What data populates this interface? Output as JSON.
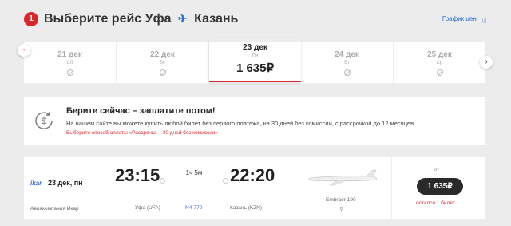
{
  "header": {
    "step": "1",
    "title_prefix": "Выберите рейс",
    "origin": "Уфа",
    "destination": "Казань",
    "schedule_link": "График цен",
    "plane_icon": "airplane-icon"
  },
  "dates": [
    {
      "date": "21 дек",
      "weekday": "Сб",
      "available": false
    },
    {
      "date": "22 дек",
      "weekday": "Вс",
      "available": false
    },
    {
      "date": "23 дек",
      "weekday": "Пн",
      "price": "1 635₽",
      "available": true,
      "selected": true
    },
    {
      "date": "24 дек",
      "weekday": "Вт",
      "available": false
    },
    {
      "date": "25 дек",
      "weekday": "Ср",
      "available": false
    }
  ],
  "nav": {
    "prev": "‹",
    "next": "›"
  },
  "promo": {
    "heading": "Берите сейчас – заплатите потом!",
    "text": "На нашем сайте вы можете купить любой билет без первого платежа, на 30 дней без комиссии, с рассрочкой до 12 месяцев.",
    "link": "Выберите способ оплаты «Рассрочка – 30 дней без комиссии»",
    "icon": "clock-dollar-icon"
  },
  "flight": {
    "airline_logo": "ikar",
    "date": "23 дек, пн",
    "airline": "Авиакомпания Икар",
    "departure_time": "23:15",
    "arrival_time": "22:20",
    "duration": "1ч 5м",
    "from": "Уфа (UFA)",
    "flight_number": "N4-770",
    "to": "Казань (KZN)",
    "aircraft": "Embraer 190",
    "price_prefix": "от",
    "price": "1 635₽",
    "seats_left": "остался 1 билет"
  },
  "colors": {
    "accent": "#d9262b",
    "link": "#2d6dd6",
    "price_button": "#2a2a2a"
  }
}
